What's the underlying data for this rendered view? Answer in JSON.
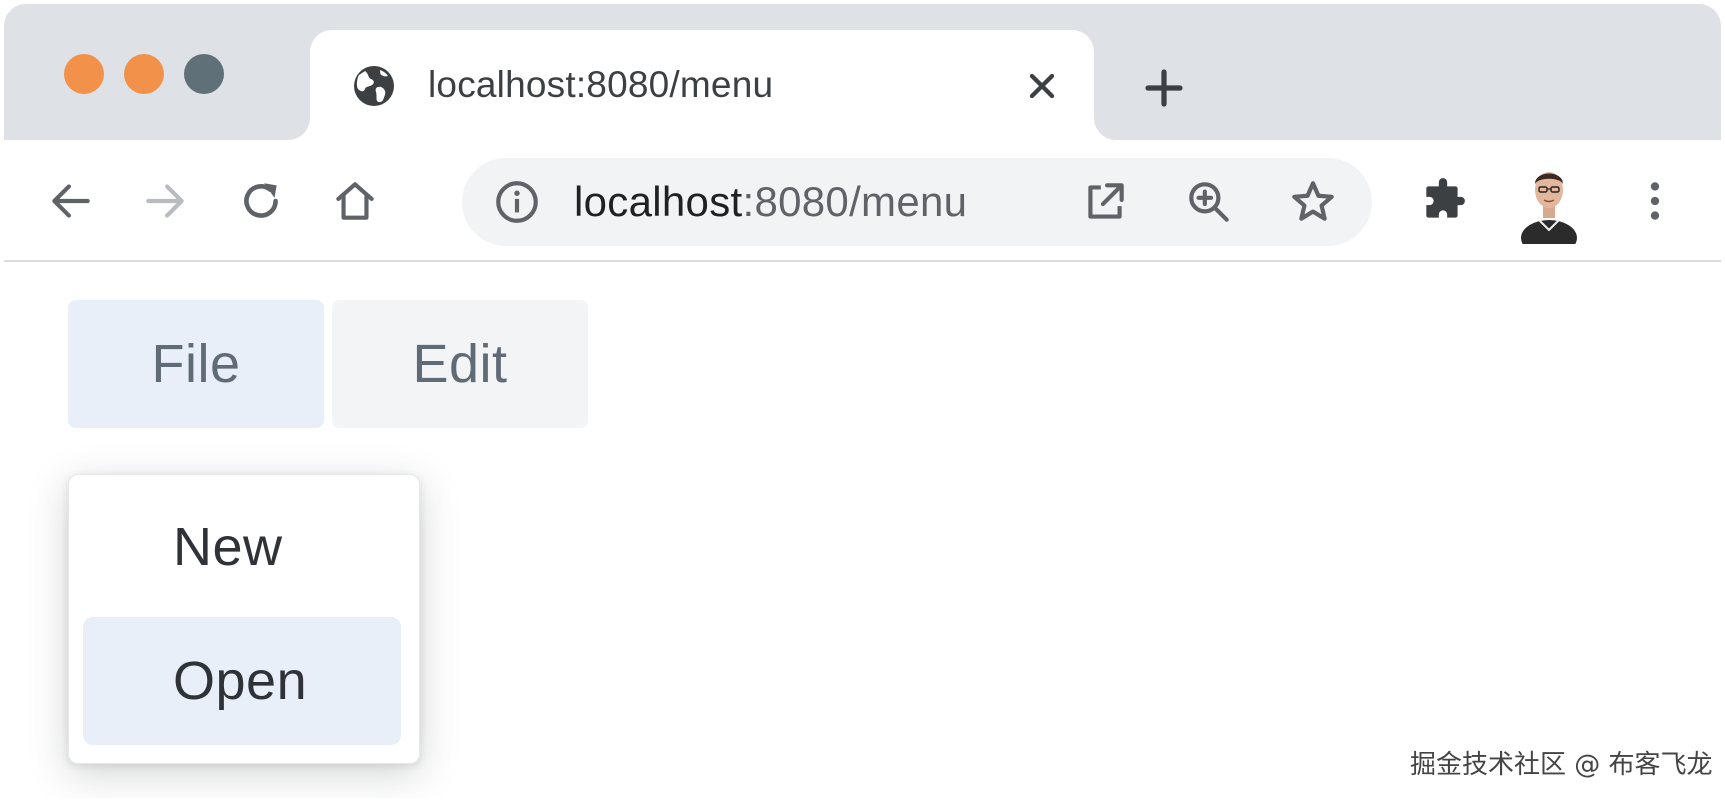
{
  "browser": {
    "traffic_lights": {
      "close_color": "#f2914a",
      "minimize_color": "#f2914a",
      "maximize_color": "#5f7078"
    },
    "tab": {
      "title": "localhost:8080/menu",
      "favicon": "globe-icon",
      "close_icon": "close-icon"
    },
    "new_tab_icon": "plus-icon",
    "toolbar": {
      "back_icon": "arrow-left-icon",
      "forward_icon": "arrow-right-icon",
      "reload_icon": "reload-icon",
      "home_icon": "home-icon",
      "address": {
        "info_icon": "info-icon",
        "host": "localhost",
        "rest": ":8080/menu",
        "open_external_icon": "open-external-icon",
        "zoom_icon": "zoom-in-icon",
        "bookmark_icon": "star-icon"
      },
      "extensions_icon": "puzzle-icon",
      "profile": "avatar",
      "menu_icon": "kebab-menu-icon"
    }
  },
  "page": {
    "menubar": {
      "items": [
        {
          "label": "File",
          "active": true
        },
        {
          "label": "Edit",
          "active": false
        }
      ]
    },
    "dropdown": {
      "items": [
        {
          "label": "New",
          "highlighted": false
        },
        {
          "label": "Open",
          "highlighted": true
        }
      ]
    }
  },
  "watermark": "掘金技术社区 @ 布客飞龙",
  "colors": {
    "menu_active_bg": "#e8eff8",
    "menu_bg": "#f3f4f6",
    "tabstrip_bg": "#dee1e6",
    "omnibox_bg": "#f1f3f4"
  }
}
